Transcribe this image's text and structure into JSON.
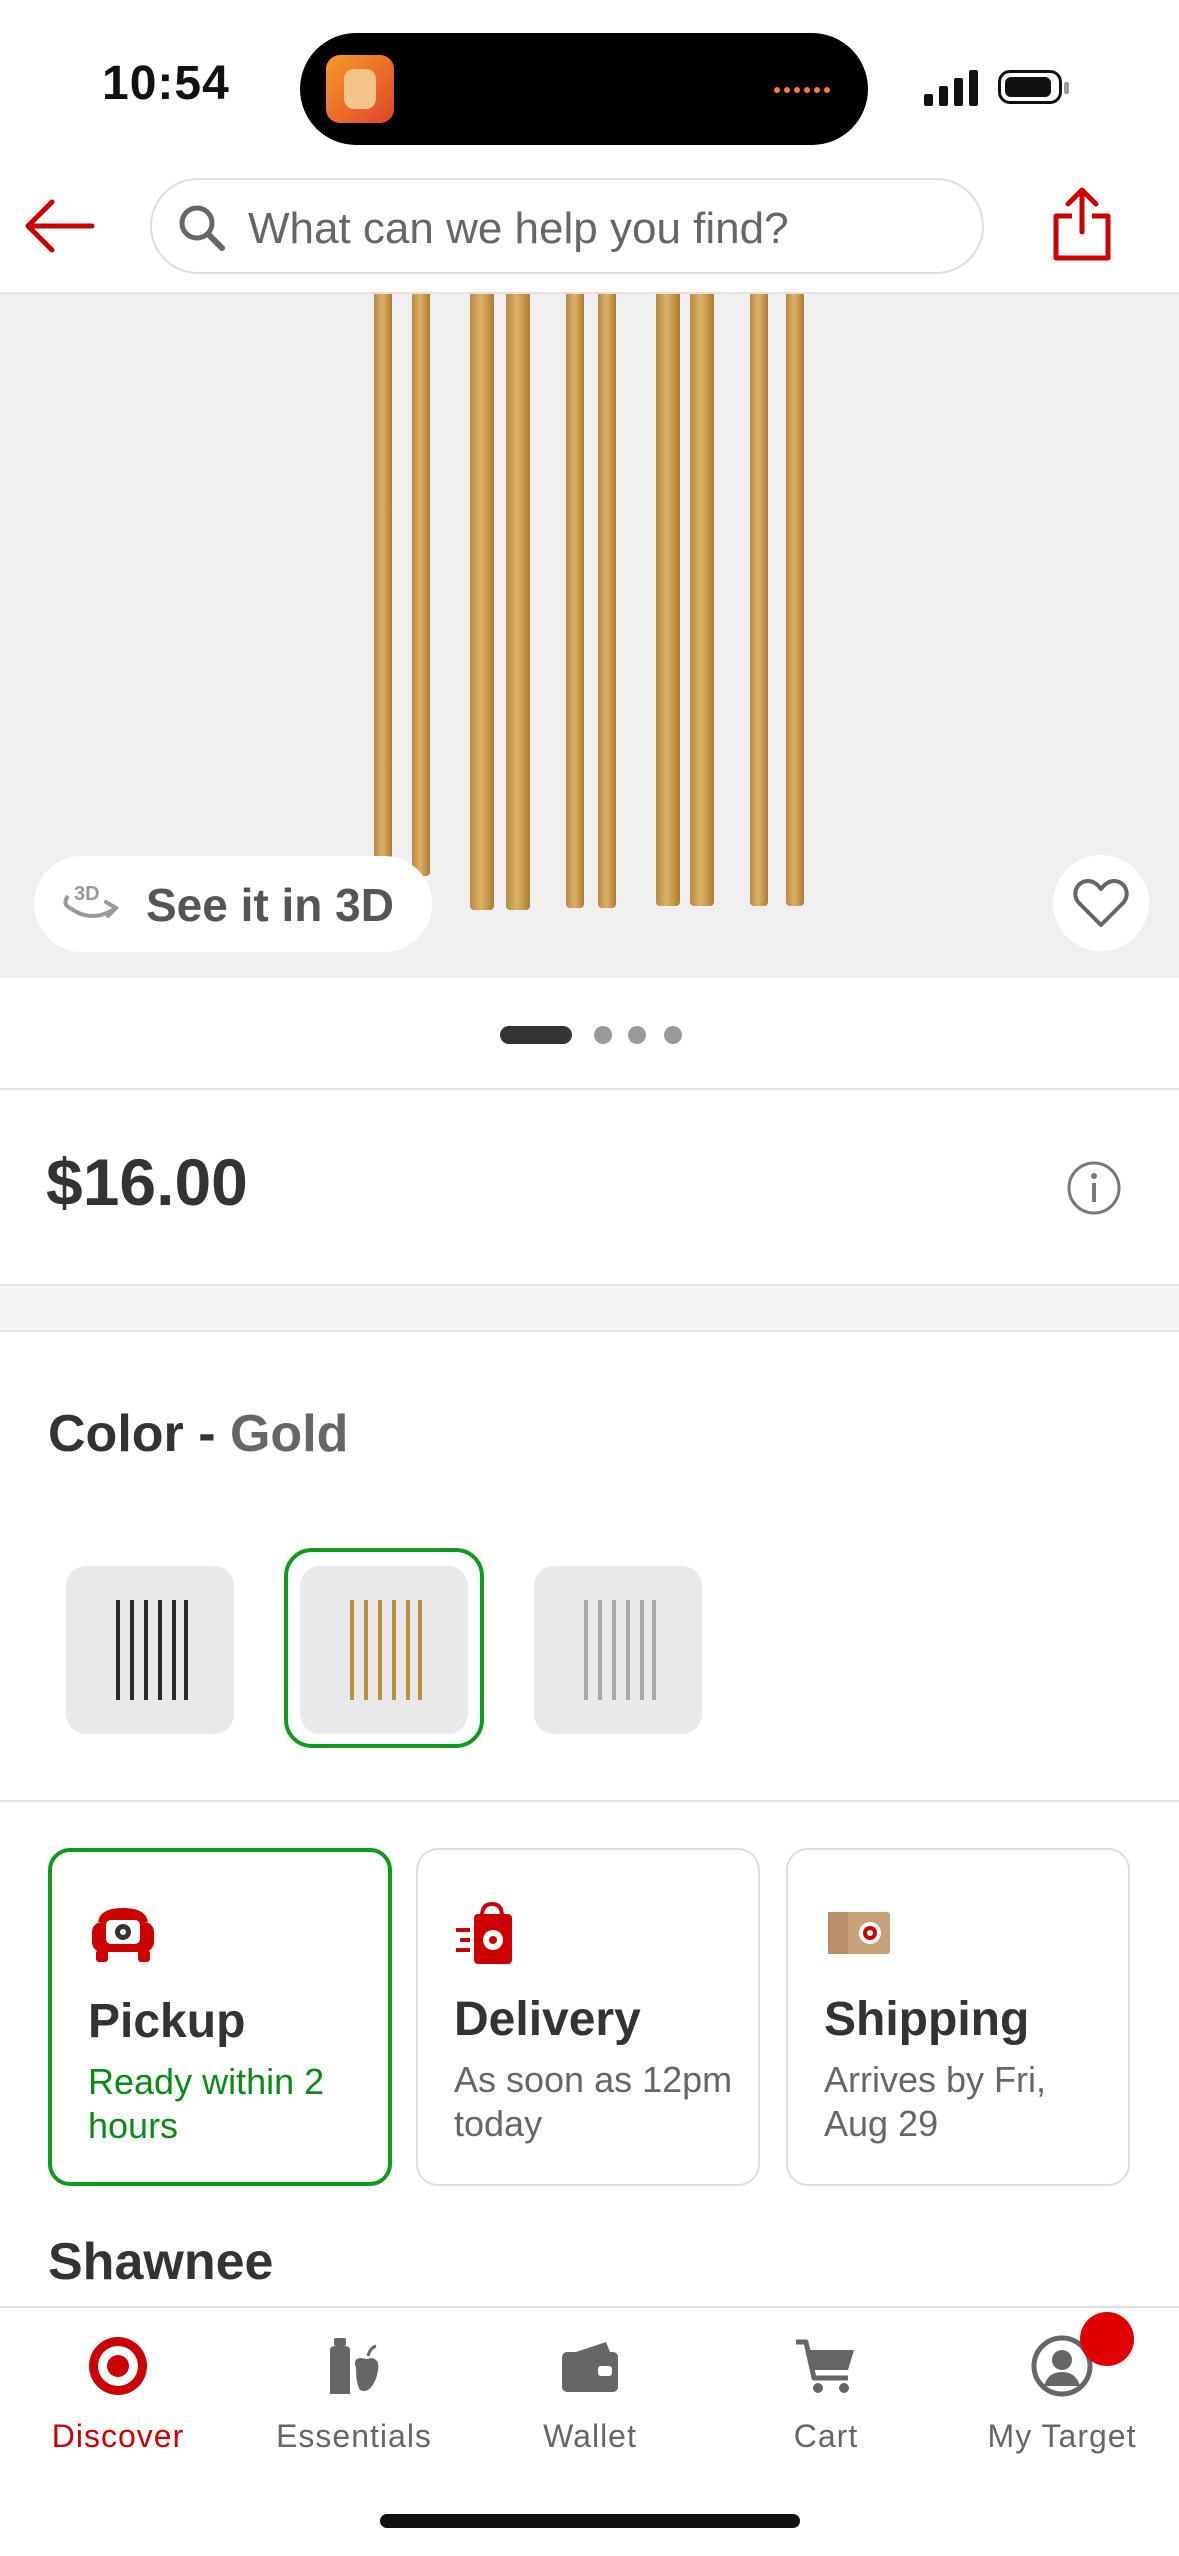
{
  "status_bar": {
    "time": "10:54"
  },
  "header": {
    "search_placeholder": "What can we help you find?"
  },
  "hero": {
    "view_3d_label": "See it in 3D",
    "image_count": 4,
    "active_index": 0
  },
  "price": {
    "amount": "$16.00"
  },
  "color": {
    "label": "Color",
    "separator": " - ",
    "selected": "Gold",
    "options": [
      {
        "name": "Black",
        "hex": "#2b2b2b"
      },
      {
        "name": "Gold",
        "hex": "#b8913f"
      },
      {
        "name": "Silver",
        "hex": "#a8a8a8"
      }
    ]
  },
  "fulfillment": [
    {
      "title": "Pickup",
      "subtitle": "Ready within 2 hours",
      "selected": true
    },
    {
      "title": "Delivery",
      "subtitle": "As soon as 12pm today",
      "selected": false
    },
    {
      "title": "Shipping",
      "subtitle": "Arrives by Fri, Aug 29",
      "selected": false
    }
  ],
  "store": {
    "name": "Shawnee"
  },
  "tabs": [
    {
      "label": "Discover",
      "active": true
    },
    {
      "label": "Essentials",
      "active": false
    },
    {
      "label": "Wallet",
      "active": false
    },
    {
      "label": "Cart",
      "active": false
    },
    {
      "label": "My Target",
      "active": false
    }
  ],
  "colors": {
    "brand_red": "#cc0000",
    "selected_green": "#0c9b1c"
  }
}
